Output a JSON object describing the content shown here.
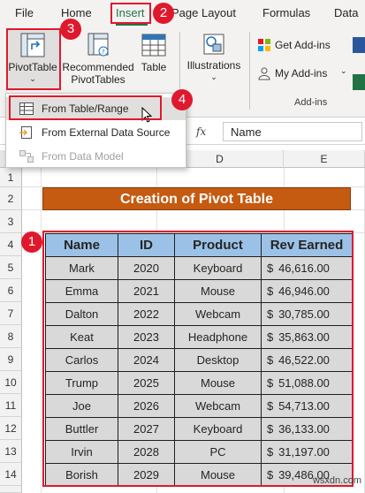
{
  "ribbon_tabs": {
    "file": "File",
    "home": "Home",
    "insert": "Insert",
    "page_layout": "Page Layout",
    "formulas": "Formulas",
    "data": "Data"
  },
  "ribbon": {
    "pivot_table": "PivotTable",
    "recommended_line1": "Recommended",
    "recommended_line2": "PivotTables",
    "table": "Table",
    "illustrations": "Illustrations",
    "get_addins": "Get Add-ins",
    "my_addins": "My Add-ins",
    "addins_group": "Add-ins"
  },
  "pivot_menu": {
    "from_table_range": "From Table/Range",
    "from_external": "From External Data Source",
    "from_data_model": "From Data Model"
  },
  "formula_bar": {
    "fx": "fx",
    "value": "Name"
  },
  "columns": [
    "D",
    "E"
  ],
  "rows": [
    "1",
    "2",
    "3",
    "4",
    "5",
    "6",
    "7",
    "8",
    "9",
    "10",
    "11",
    "12",
    "13",
    "14"
  ],
  "sheet": {
    "title": "Creation of Pivot Table",
    "headers": [
      "Name",
      "ID",
      "Product",
      "Rev Earned"
    ],
    "currency": "$",
    "records": [
      {
        "name": "Mark",
        "id": "2020",
        "product": "Keyboard",
        "rev": "46,616.00"
      },
      {
        "name": "Emma",
        "id": "2021",
        "product": "Mouse",
        "rev": "46,946.00"
      },
      {
        "name": "Dalton",
        "id": "2022",
        "product": "Webcam",
        "rev": "30,785.00"
      },
      {
        "name": "Keat",
        "id": "2023",
        "product": "Headphone",
        "rev": "35,863.00"
      },
      {
        "name": "Carlos",
        "id": "2024",
        "product": "Desktop",
        "rev": "46,522.00"
      },
      {
        "name": "Trump",
        "id": "2025",
        "product": "Mouse",
        "rev": "51,088.00"
      },
      {
        "name": "Joe",
        "id": "2026",
        "product": "Webcam",
        "rev": "54,713.00"
      },
      {
        "name": "Buttler",
        "id": "2027",
        "product": "Keyboard",
        "rev": "36,133.00"
      },
      {
        "name": "Irvin",
        "id": "2028",
        "product": "PC",
        "rev": "31,197.00"
      },
      {
        "name": "Borish",
        "id": "2029",
        "product": "Mouse",
        "rev": "39,486.00"
      }
    ]
  },
  "badges": [
    "1",
    "2",
    "3",
    "4"
  ],
  "watermark": "wsxdn.com",
  "colors": {
    "title_fill": "#c55a11",
    "header_fill": "#9bc2e6",
    "cell_fill": "#d9d9d9",
    "highlight": "#e0182d",
    "excel_green": "#217346"
  }
}
